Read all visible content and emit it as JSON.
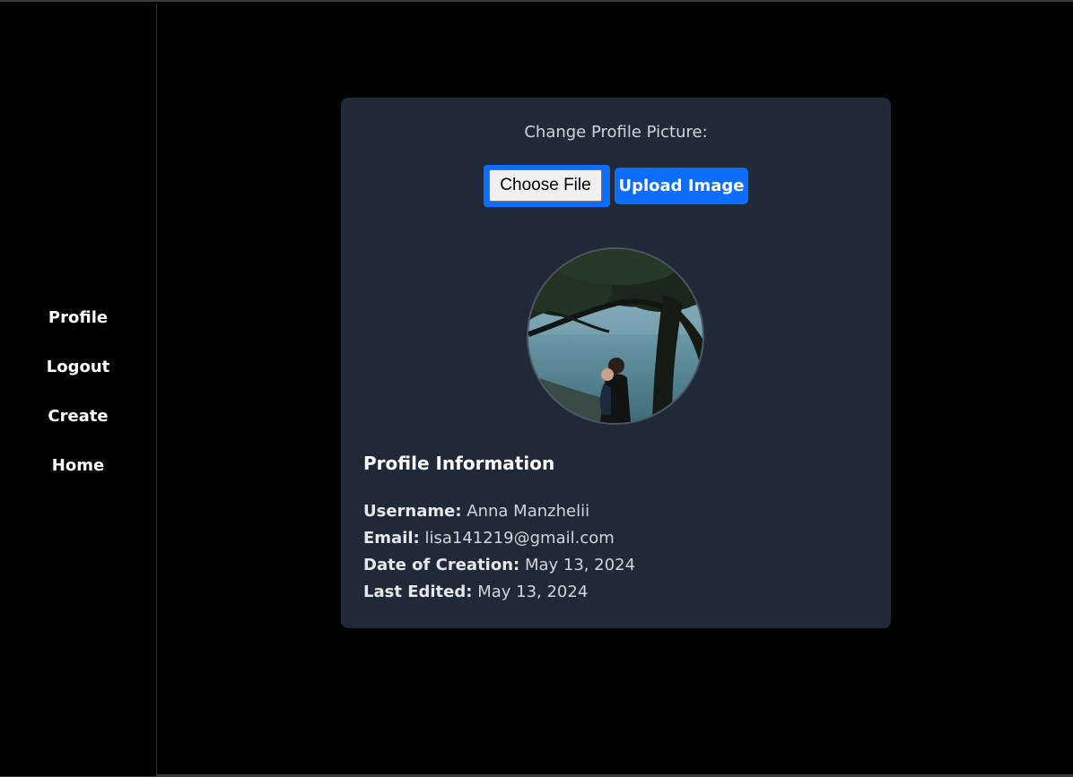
{
  "nav": {
    "items": [
      {
        "label": "Profile"
      },
      {
        "label": "Logout"
      },
      {
        "label": "Create"
      },
      {
        "label": "Home"
      }
    ]
  },
  "upload": {
    "title": "Change Profile Picture:",
    "choose_file_label": "Choose File",
    "upload_button_label": "Upload Image"
  },
  "avatar": {
    "icon": "profile-photo"
  },
  "profile": {
    "section_title": "Profile Information",
    "fields": [
      {
        "label": "Username:",
        "value": "Anna Manzhelii"
      },
      {
        "label": "Email:",
        "value": "lisa141219@gmail.com"
      },
      {
        "label": "Date of Creation:",
        "value": "May 13, 2024"
      },
      {
        "label": "Last Edited:",
        "value": "May 13, 2024"
      }
    ]
  },
  "colors": {
    "background": "#000000",
    "card": "#1f2937",
    "accent": "#0d6efd"
  }
}
